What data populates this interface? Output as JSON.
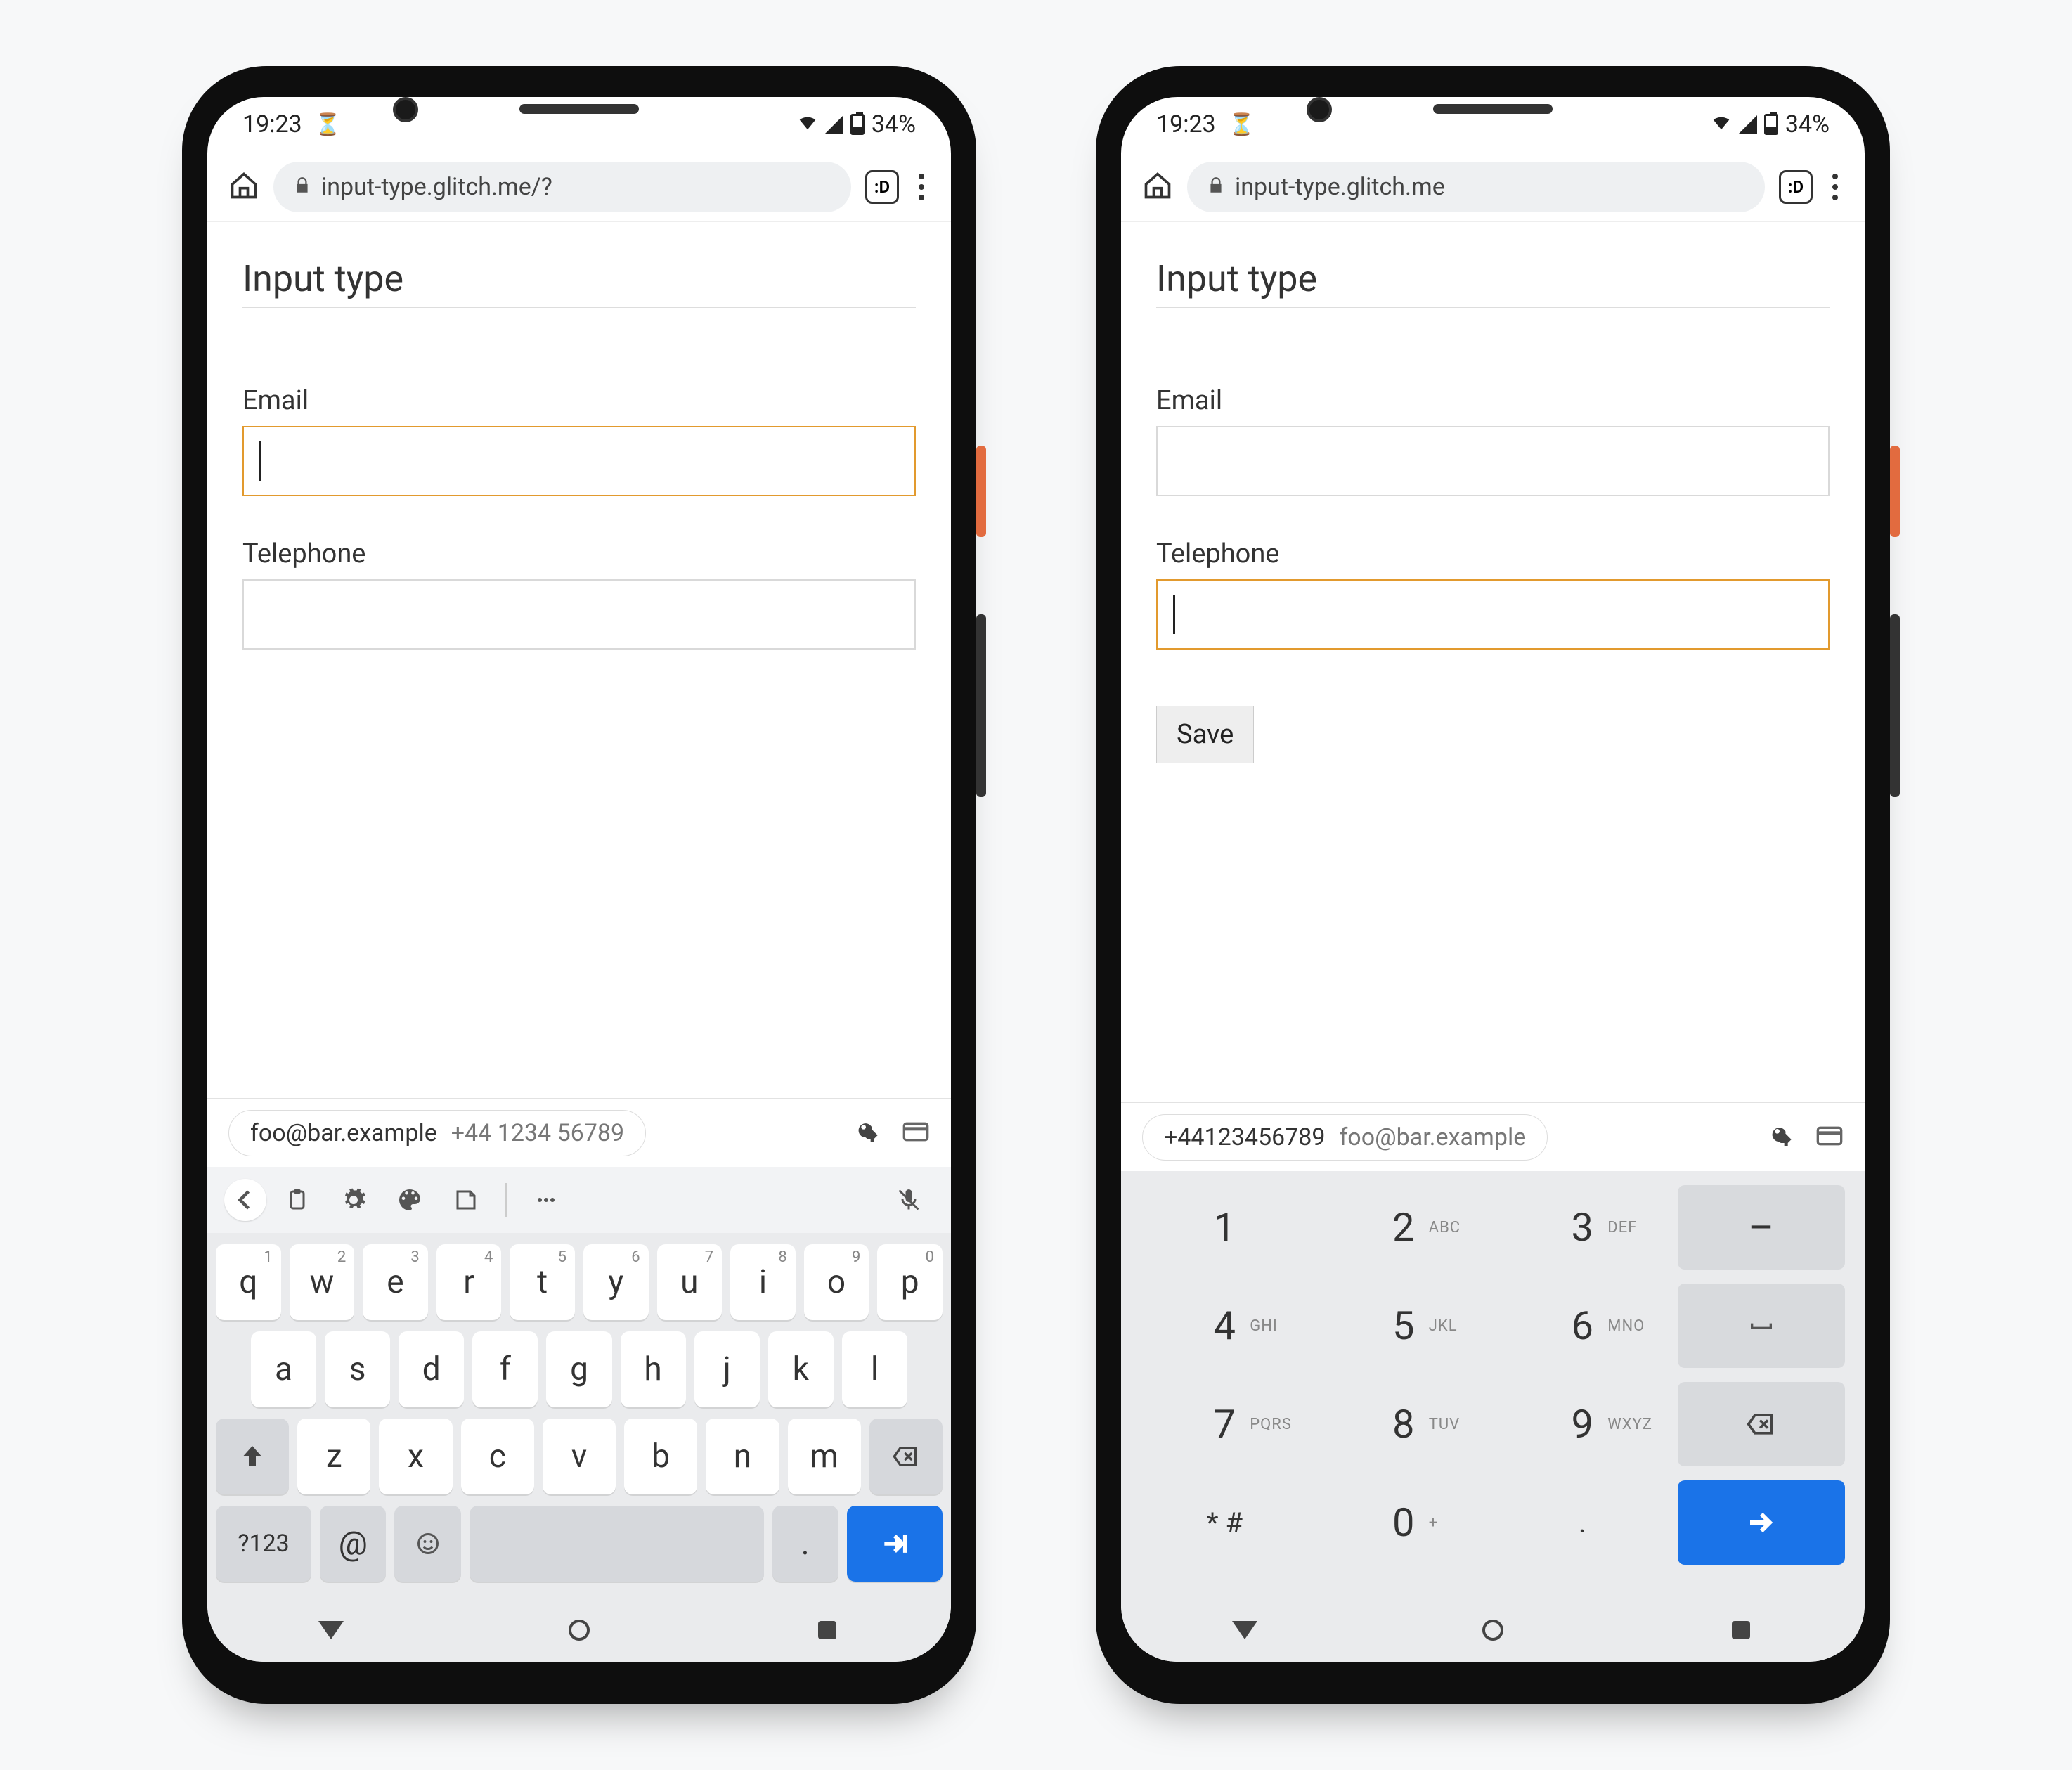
{
  "status": {
    "time": "19:23",
    "battery": "34%"
  },
  "chrome": {
    "url_left": "input-type.glitch.me/?",
    "url_right": "input-type.glitch.me",
    "tab_label": ":D"
  },
  "page": {
    "title": "Input type",
    "email_label": "Email",
    "telephone_label": "Telephone",
    "save_label": "Save"
  },
  "autofill": {
    "email": "foo@bar.example",
    "phone_spaced": "+44 1234 56789",
    "phone_compact": "+44123456789"
  },
  "qwerty": {
    "row1": [
      {
        "k": "q",
        "n": "1"
      },
      {
        "k": "w",
        "n": "2"
      },
      {
        "k": "e",
        "n": "3"
      },
      {
        "k": "r",
        "n": "4"
      },
      {
        "k": "t",
        "n": "5"
      },
      {
        "k": "y",
        "n": "6"
      },
      {
        "k": "u",
        "n": "7"
      },
      {
        "k": "i",
        "n": "8"
      },
      {
        "k": "o",
        "n": "9"
      },
      {
        "k": "p",
        "n": "0"
      }
    ],
    "row2": [
      "a",
      "s",
      "d",
      "f",
      "g",
      "h",
      "j",
      "k",
      "l"
    ],
    "row3": [
      "z",
      "x",
      "c",
      "v",
      "b",
      "n",
      "m"
    ],
    "sym_label": "?123",
    "at_label": "@",
    "dot_label": "."
  },
  "numpad": {
    "rows": [
      [
        {
          "k": "1"
        },
        {
          "k": "2",
          "l": "ABC"
        },
        {
          "k": "3",
          "l": "DEF"
        },
        {
          "k": "–",
          "fn": true
        }
      ],
      [
        {
          "k": "4",
          "l": "GHI"
        },
        {
          "k": "5",
          "l": "JKL"
        },
        {
          "k": "6",
          "l": "MNO"
        },
        {
          "k": "⌴",
          "fn": true,
          "space": true
        }
      ],
      [
        {
          "k": "7",
          "l": "PQRS"
        },
        {
          "k": "8",
          "l": "TUV"
        },
        {
          "k": "9",
          "l": "WXYZ"
        },
        {
          "k": "bksp",
          "fn": true
        }
      ],
      [
        {
          "k": "* #",
          "sym": true
        },
        {
          "k": "0",
          "l": "+"
        },
        {
          "k": ".",
          "sym": true
        },
        {
          "k": "enter",
          "fn": true
        }
      ]
    ]
  }
}
